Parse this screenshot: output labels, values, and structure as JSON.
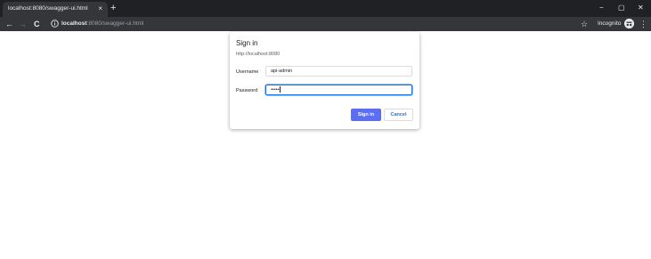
{
  "browser": {
    "tab_title": "localhost:8080/swagger-ui.html",
    "tab_close": "×",
    "new_tab": "+",
    "window_controls": {
      "minimize": "−",
      "restore": "▢",
      "close": "✕"
    },
    "nav": {
      "back": "←",
      "forward": "→",
      "reload": "C"
    },
    "url_host": "localhost",
    "url_path": ":8080/swagger-ui.html",
    "star": "☆",
    "incognito_label": "Incognito",
    "menu": "⋮"
  },
  "dialog": {
    "title": "Sign in",
    "origin": "http://localhost:8080",
    "username_label": "Username",
    "username_value": "api-admin",
    "password_label": "Password",
    "password_value": "•••••",
    "sign_in_label": "Sign in",
    "cancel_label": "Cancel"
  },
  "colors": {
    "tabstrip": "#202124",
    "toolbar": "#35363a",
    "primary_button": "#5b6ff0",
    "focus_ring": "#1a73e8"
  }
}
